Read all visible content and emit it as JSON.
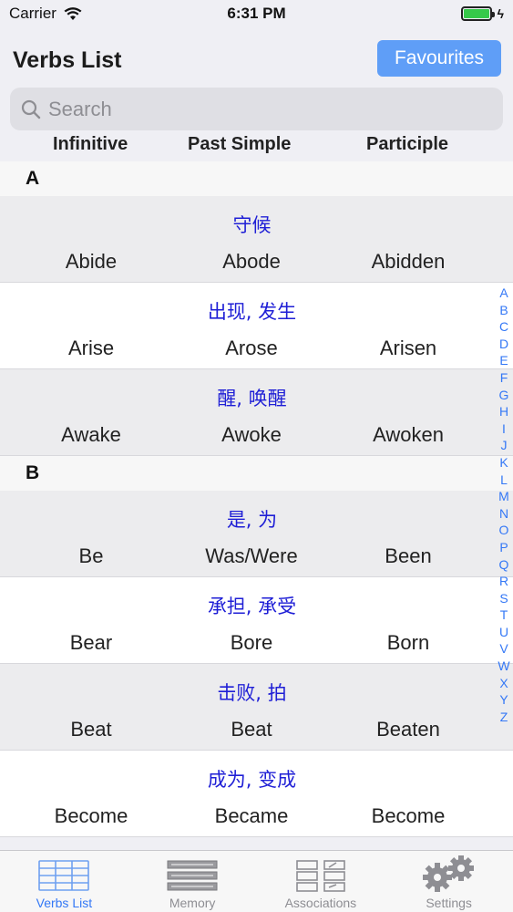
{
  "status": {
    "carrier": "Carrier",
    "time": "6:31 PM",
    "battery_level": 1.0
  },
  "nav": {
    "title": "Verbs List",
    "favourites_label": "Favourites"
  },
  "search": {
    "placeholder": "Search"
  },
  "columns": {
    "infinitive": "Infinitive",
    "past_simple": "Past Simple",
    "participle": "Participle"
  },
  "sections": [
    {
      "letter": "A",
      "rows": [
        {
          "translation": "守候",
          "infinitive": "Abide",
          "past": "Abode",
          "participle": "Abidden"
        },
        {
          "translation": "出现, 发生",
          "infinitive": "Arise",
          "past": "Arose",
          "participle": "Arisen"
        },
        {
          "translation": "醒, 唤醒",
          "infinitive": "Awake",
          "past": "Awoke",
          "participle": "Awoken"
        }
      ]
    },
    {
      "letter": "B",
      "rows": [
        {
          "translation": "是, 为",
          "infinitive": "Be",
          "past": "Was/Were",
          "participle": "Been"
        },
        {
          "translation": "承担, 承受",
          "infinitive": "Bear",
          "past": "Bore",
          "participle": "Born"
        },
        {
          "translation": "击败, 拍",
          "infinitive": "Beat",
          "past": "Beat",
          "participle": "Beaten"
        },
        {
          "translation": "成为, 变成",
          "infinitive": "Become",
          "past": "Became",
          "participle": "Become"
        }
      ]
    }
  ],
  "index_letters": [
    "A",
    "B",
    "C",
    "D",
    "E",
    "F",
    "G",
    "H",
    "I",
    "J",
    "K",
    "L",
    "M",
    "N",
    "O",
    "P",
    "Q",
    "R",
    "S",
    "T",
    "U",
    "V",
    "W",
    "X",
    "Y",
    "Z"
  ],
  "tabs": [
    {
      "label": "Verbs List",
      "icon": "list-icon",
      "active": true
    },
    {
      "label": "Memory",
      "icon": "memory-icon",
      "active": false
    },
    {
      "label": "Associations",
      "icon": "associations-icon",
      "active": false
    },
    {
      "label": "Settings",
      "icon": "gear-icon",
      "active": false
    }
  ],
  "colors": {
    "accent": "#3478f6",
    "button": "#5f9ef7",
    "translation": "#1f1fd6"
  }
}
